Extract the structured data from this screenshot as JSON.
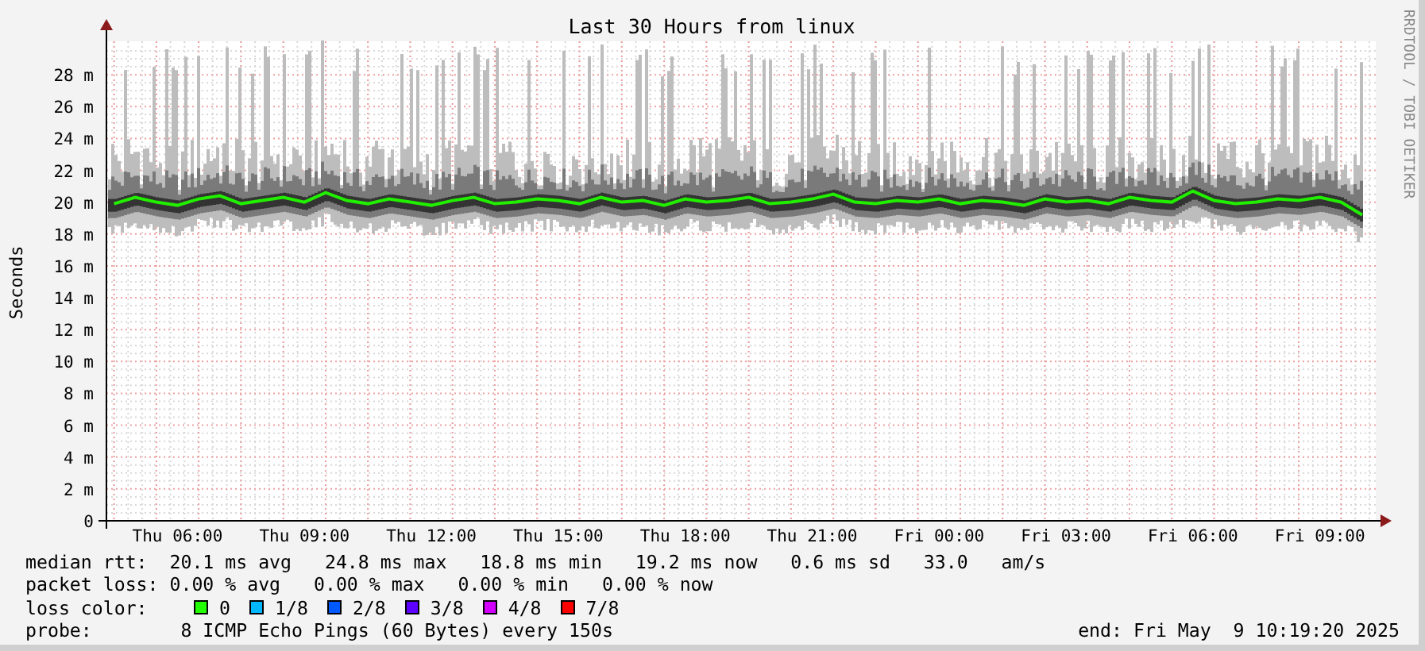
{
  "graph": {
    "credit": "RRDTOOL / TOBI OETIKER",
    "chart_data": {
      "type": "line",
      "title": "Last 30 Hours from linux",
      "ylabel": "Seconds",
      "grid": true,
      "ylim": [
        0,
        30
      ],
      "yticks": [
        {
          "value": 0,
          "label": "0"
        },
        {
          "value": 2,
          "label": "2 m"
        },
        {
          "value": 4,
          "label": "4 m"
        },
        {
          "value": 6,
          "label": "6 m"
        },
        {
          "value": 8,
          "label": "8 m"
        },
        {
          "value": 10,
          "label": "10 m"
        },
        {
          "value": 12,
          "label": "12 m"
        },
        {
          "value": 14,
          "label": "14 m"
        },
        {
          "value": 16,
          "label": "16 m"
        },
        {
          "value": 18,
          "label": "18 m"
        },
        {
          "value": 20,
          "label": "20 m"
        },
        {
          "value": 22,
          "label": "22 m"
        },
        {
          "value": 24,
          "label": "24 m"
        },
        {
          "value": 26,
          "label": "26 m"
        },
        {
          "value": 28,
          "label": "28 m"
        }
      ],
      "categories": [
        null,
        null,
        null,
        "Thu 06:00",
        null,
        null,
        null,
        null,
        null,
        "Thu 09:00",
        null,
        null,
        null,
        null,
        null,
        "Thu 12:00",
        null,
        null,
        null,
        null,
        null,
        "Thu 15:00",
        null,
        null,
        null,
        null,
        null,
        "Thu 18:00",
        null,
        null,
        null,
        null,
        null,
        "Thu 21:00",
        null,
        null,
        null,
        null,
        null,
        "Fri 00:00",
        null,
        null,
        null,
        null,
        null,
        "Fri 03:00",
        null,
        null,
        null,
        null,
        null,
        "Fri 06:00",
        null,
        null,
        null,
        null,
        null,
        "Fri 09:00",
        null,
        null
      ],
      "series": [
        {
          "color": "#22ee00",
          "values": [
            19.9,
            20.3,
            20.0,
            19.8,
            20.2,
            20.4,
            19.9,
            20.1,
            20.3,
            20.0,
            20.6,
            20.1,
            19.9,
            20.2,
            20.0,
            19.8,
            20.1,
            20.3,
            19.9,
            20.0,
            20.2,
            20.1,
            19.9,
            20.3,
            20.0,
            20.1,
            19.8,
            20.2,
            20.0,
            20.1,
            20.3,
            19.9,
            20.0,
            20.2,
            20.5,
            20.0,
            19.9,
            20.1,
            20.0,
            20.2,
            19.9,
            20.1,
            20.0,
            19.8,
            20.2,
            20.0,
            20.1,
            19.9,
            20.3,
            20.1,
            20.0,
            20.7,
            20.1,
            19.9,
            20.0,
            20.2,
            20.1,
            20.3,
            20.0,
            19.2
          ]
        }
      ]
    }
  },
  "stats": [
    {
      "kind": "text",
      "text": "median rtt:  20.1 ms avg   24.8 ms max   18.8 ms min   19.2 ms now   0.6 ms sd   33.0   am/s"
    },
    {
      "kind": "text",
      "text": "packet loss: 0.00 % avg   0.00 % max   0.00 % min   0.00 % now"
    },
    {
      "kind": "legend",
      "label": "loss color:",
      "items": [
        {
          "label": "0",
          "color": "#22ff00"
        },
        {
          "label": "1/8",
          "color": "#00b8ff"
        },
        {
          "label": "2/8",
          "color": "#0059ff"
        },
        {
          "label": "3/8",
          "color": "#5e00ff"
        },
        {
          "label": "4/8",
          "color": "#d400ff"
        },
        {
          "label": "7/8",
          "color": "#ff0000"
        }
      ]
    },
    {
      "kind": "probe",
      "text": "probe:        8 ICMP Echo Pings (60 Bytes) every 150s",
      "end": "end: Fri May  9 10:19:20 2025"
    }
  ]
}
